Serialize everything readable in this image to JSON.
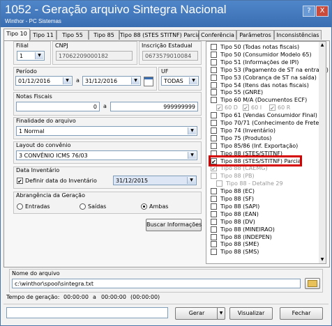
{
  "window": {
    "title": "1052 - Geração arquivo Sintegra Nacional",
    "subtitle": "Winthor - PC Sistemas",
    "help_label": "?",
    "close_label": "X"
  },
  "tabs": [
    {
      "label": "Tipo 10"
    },
    {
      "label": "Tipo 11"
    },
    {
      "label": "Tipo 55"
    },
    {
      "label": "Tipo 85"
    },
    {
      "label": "Tipo 88 (STES STITNF) Parcial"
    },
    {
      "label": "Conferência"
    },
    {
      "label": "Parâmetros"
    },
    {
      "label": "Inconsistências"
    }
  ],
  "filial": {
    "label": "Filial",
    "value": "1"
  },
  "cnpj": {
    "label": "CNPJ",
    "value": "17062209000182"
  },
  "ie": {
    "label": "Inscrição Estadual",
    "value": "0673579010084"
  },
  "periodo": {
    "label": "Período",
    "start": "01/12/2016",
    "sep": "a",
    "end": "31/12/2016"
  },
  "uf": {
    "label": "UF",
    "value": "TODAS"
  },
  "notas": {
    "label": "Notas Fiscais",
    "start": "0",
    "sep": "a",
    "end": "999999999"
  },
  "finalidade": {
    "label": "Finalidade do arquivo",
    "value": "1 Normal"
  },
  "layout": {
    "label": "Layout do convênio",
    "value": "3 CONVÊNIO ICMS 76/03"
  },
  "inventario": {
    "label": "Data Inventário",
    "check_label": "Definir data do Inventário",
    "checked": true,
    "date": "31/12/2015"
  },
  "abrangencia": {
    "label": "Abrangência da Geração",
    "options": [
      {
        "label": "Entradas",
        "selected": false
      },
      {
        "label": "Saídas",
        "selected": false
      },
      {
        "label": "Ambas",
        "selected": true
      }
    ]
  },
  "buscar_label": "Buscar Informações",
  "types": [
    {
      "label": "Tipo 50 (Todas notas fiscais)",
      "checked": false,
      "disabled": false
    },
    {
      "label": "Tipo 50 (Consumidor Modelo 65)",
      "checked": false,
      "disabled": false
    },
    {
      "label": "Tipo 51 (Informações de IPI)",
      "checked": false,
      "disabled": false
    },
    {
      "label": "Tipo 53 (Pagamento de ST na entrada)",
      "checked": false,
      "disabled": false
    },
    {
      "label": "Tipo 53 (Cobrança de ST na saída)",
      "checked": false,
      "disabled": false
    },
    {
      "label": "Tipo 54 (Itens das notas fiscais)",
      "checked": false,
      "disabled": false
    },
    {
      "label": "Tipo 55 (GNRE)",
      "checked": false,
      "disabled": false
    },
    {
      "label": "Tipo 60 M/A (Documentos ECF)",
      "checked": false,
      "disabled": false
    },
    {
      "label": "Tipo 61 (Vendas Consumidor Final)",
      "checked": false,
      "disabled": false
    },
    {
      "label": "Tipo 70/71 (Conhecimento de Frete)",
      "checked": false,
      "disabled": false
    },
    {
      "label": "Tipo 74 (Inventário)",
      "checked": false,
      "disabled": false
    },
    {
      "label": "Tipo 75 (Produtos)",
      "checked": false,
      "disabled": false
    },
    {
      "label": "Tipo 85/86 (Inf. Exportação)",
      "checked": false,
      "disabled": false
    },
    {
      "label": "Tipo 88 (STES/STITNF)",
      "checked": false,
      "disabled": false
    },
    {
      "label": "Tipo 88 (STES/STITNF) Parcial",
      "checked": true,
      "disabled": false
    },
    {
      "label": "Tipo 88 (CAEMG)",
      "checked": true,
      "disabled": true
    },
    {
      "label": "Tipo 88 (PB)",
      "checked": false,
      "disabled": true
    },
    {
      "label": "Tipo 88 (EC)",
      "checked": false,
      "disabled": false
    },
    {
      "label": "Tipo 88 (SF)",
      "checked": false,
      "disabled": false
    },
    {
      "label": "Tipo 88 (SAPI)",
      "checked": false,
      "disabled": false
    },
    {
      "label": "Tipo 88 (EAN)",
      "checked": false,
      "disabled": false
    },
    {
      "label": "Tipo 88 (DV)",
      "checked": false,
      "disabled": false
    },
    {
      "label": "Tipo 88 (MINEIRAO)",
      "checked": false,
      "disabled": false
    },
    {
      "label": "Tipo 88 (INDEPEN)",
      "checked": false,
      "disabled": false
    },
    {
      "label": "Tipo 88 (SME)",
      "checked": false,
      "disabled": false
    },
    {
      "label": "Tipo 88 (SMS)",
      "checked": false,
      "disabled": false
    }
  ],
  "ecf_sub": [
    "60 D",
    "60 I",
    "60 R"
  ],
  "pb_sub": "Tipo 88 - Detalhe 29",
  "arquivo": {
    "label": "Nome do arquivo",
    "value": "c:\\winthor\\spool\\sintegra.txt"
  },
  "tempo": {
    "label": "Tempo de geração:",
    "start": "00:00:00",
    "sep": "a",
    "end": "00:00:00",
    "total": "(00:00:00)"
  },
  "buttons": {
    "gerar": "Gerar",
    "visualizar": "Visualizar",
    "fechar": "Fechar"
  },
  "accent": "#3a6eb2",
  "highlight_color": "#d50000"
}
